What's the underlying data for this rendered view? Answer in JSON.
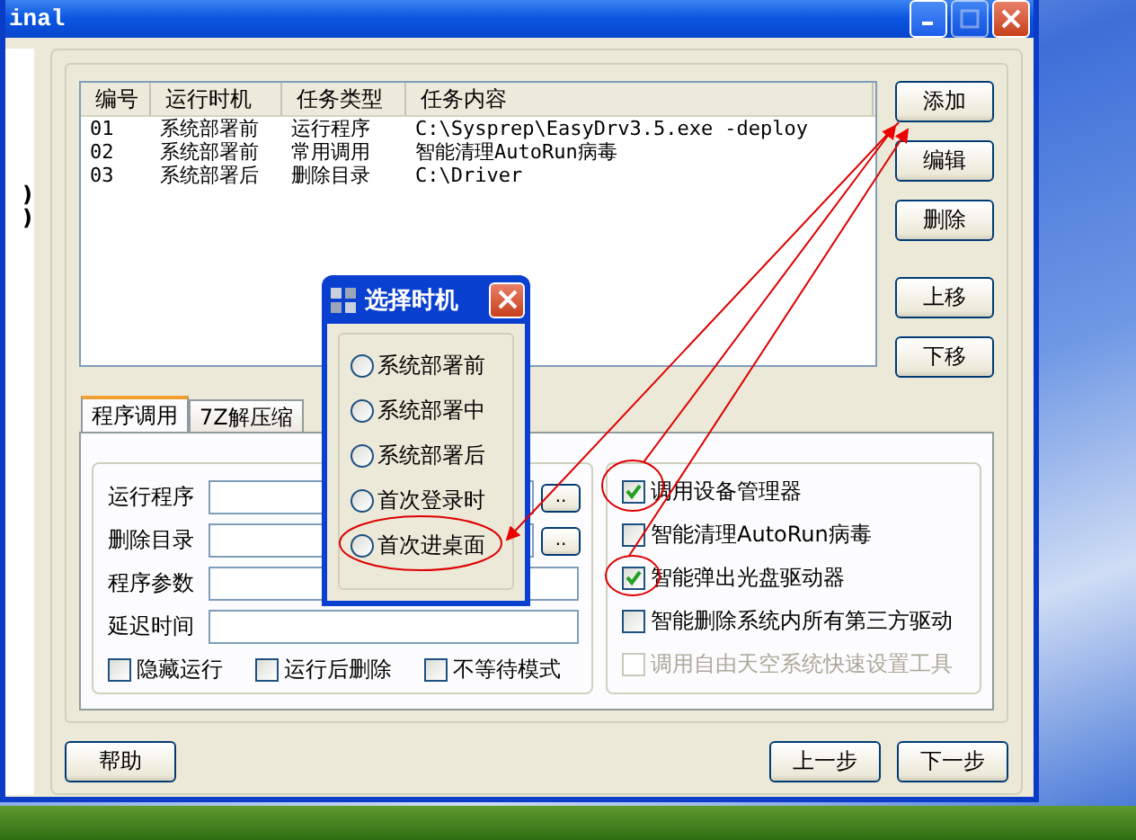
{
  "window": {
    "title": "inal"
  },
  "left_strip": [
    ")",
    ")"
  ],
  "task_list": {
    "columns": [
      "编号",
      "运行时机",
      "任务类型",
      "任务内容"
    ],
    "rows": [
      [
        "01",
        "系统部署前",
        "运行程序",
        "C:\\Sysprep\\EasyDrv3.5.exe -deploy"
      ],
      [
        "02",
        "系统部署前",
        "常用调用",
        "智能清理AutoRun病毒"
      ],
      [
        "03",
        "系统部署后",
        "删除目录",
        "C:\\Driver"
      ]
    ]
  },
  "side_buttons": [
    "添加",
    "编辑",
    "删除",
    "上移",
    "下移"
  ],
  "tabs": [
    {
      "label": "程序调用",
      "selected": true
    },
    {
      "label": "7Z解压缩",
      "selected": false
    }
  ],
  "fields": [
    {
      "label": "运行程序",
      "browse": ".."
    },
    {
      "label": "删除目录",
      "browse": ".."
    },
    {
      "label": "程序参数"
    },
    {
      "label": "延迟时间"
    }
  ],
  "options": [
    {
      "label": "隐藏运行",
      "checked": false
    },
    {
      "label": "运行后删除",
      "checked": false
    },
    {
      "label": "不等待模式",
      "checked": false
    }
  ],
  "actions": [
    {
      "label": "调用设备管理器",
      "checked": true,
      "disabled": false
    },
    {
      "label": "智能清理AutoRun病毒",
      "checked": false,
      "disabled": false
    },
    {
      "label": "智能弹出光盘驱动器",
      "checked": true,
      "disabled": false
    },
    {
      "label": "智能删除系统内所有第三方驱动",
      "checked": false,
      "disabled": false
    },
    {
      "label": "调用自由天空系统快速设置工具",
      "checked": false,
      "disabled": true
    }
  ],
  "footer": {
    "left": [
      "帮助"
    ],
    "right": [
      "上一步",
      "下一步"
    ]
  },
  "dialog": {
    "title": "选择时机",
    "options": [
      {
        "label": "系统部署前",
        "selected": false
      },
      {
        "label": "系统部署中",
        "selected": false
      },
      {
        "label": "系统部署后",
        "selected": false
      },
      {
        "label": "首次登录时",
        "selected": false
      },
      {
        "label": "首次进桌面",
        "selected": false
      }
    ]
  }
}
